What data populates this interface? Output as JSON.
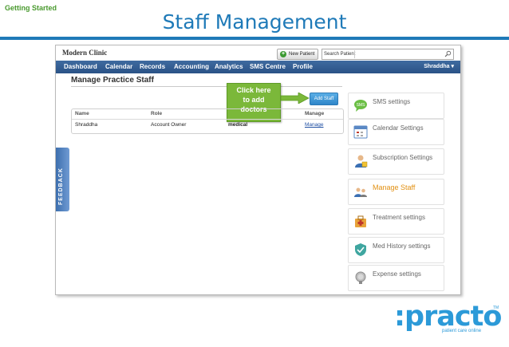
{
  "slide": {
    "section": "Getting Started",
    "title": "Staff Management"
  },
  "app": {
    "clinic_name": "Modern Clinic",
    "new_patient_label": "New Patient",
    "search_label": "Search Patient",
    "nav": [
      "Dashboard",
      "Calendar",
      "Records",
      "Accounting",
      "Analytics",
      "SMS Centre",
      "Profile"
    ],
    "user": "Shraddha ▾",
    "feedback_label": "FEEDBACK"
  },
  "page": {
    "heading": "Manage Practice Staff",
    "add_staff_label": "Add Staff",
    "callout": [
      "Click here",
      "to add",
      "doctors"
    ]
  },
  "table": {
    "columns": [
      "Name",
      "Role",
      "Manage"
    ],
    "rows": [
      {
        "name": "Shraddha",
        "role": "Account Owner",
        "specialty": "medical",
        "action": "Manage"
      }
    ]
  },
  "settings": [
    {
      "label": "SMS settings",
      "icon": "sms-icon"
    },
    {
      "label": "Calendar Settings",
      "icon": "calendar-icon"
    },
    {
      "label": "Subscription Settings",
      "icon": "subscription-icon"
    },
    {
      "label": "Manage Staff",
      "icon": "staff-icon",
      "active": true
    },
    {
      "label": "Treatment settings",
      "icon": "treatment-icon"
    },
    {
      "label": "Med History settings",
      "icon": "med-history-icon"
    },
    {
      "label": "Expense settings",
      "icon": "expense-icon"
    }
  ],
  "brand": {
    "logo_text": ":practo",
    "trademark": "TM",
    "tagline": "patient care online",
    "color": "#2c9ad8"
  }
}
